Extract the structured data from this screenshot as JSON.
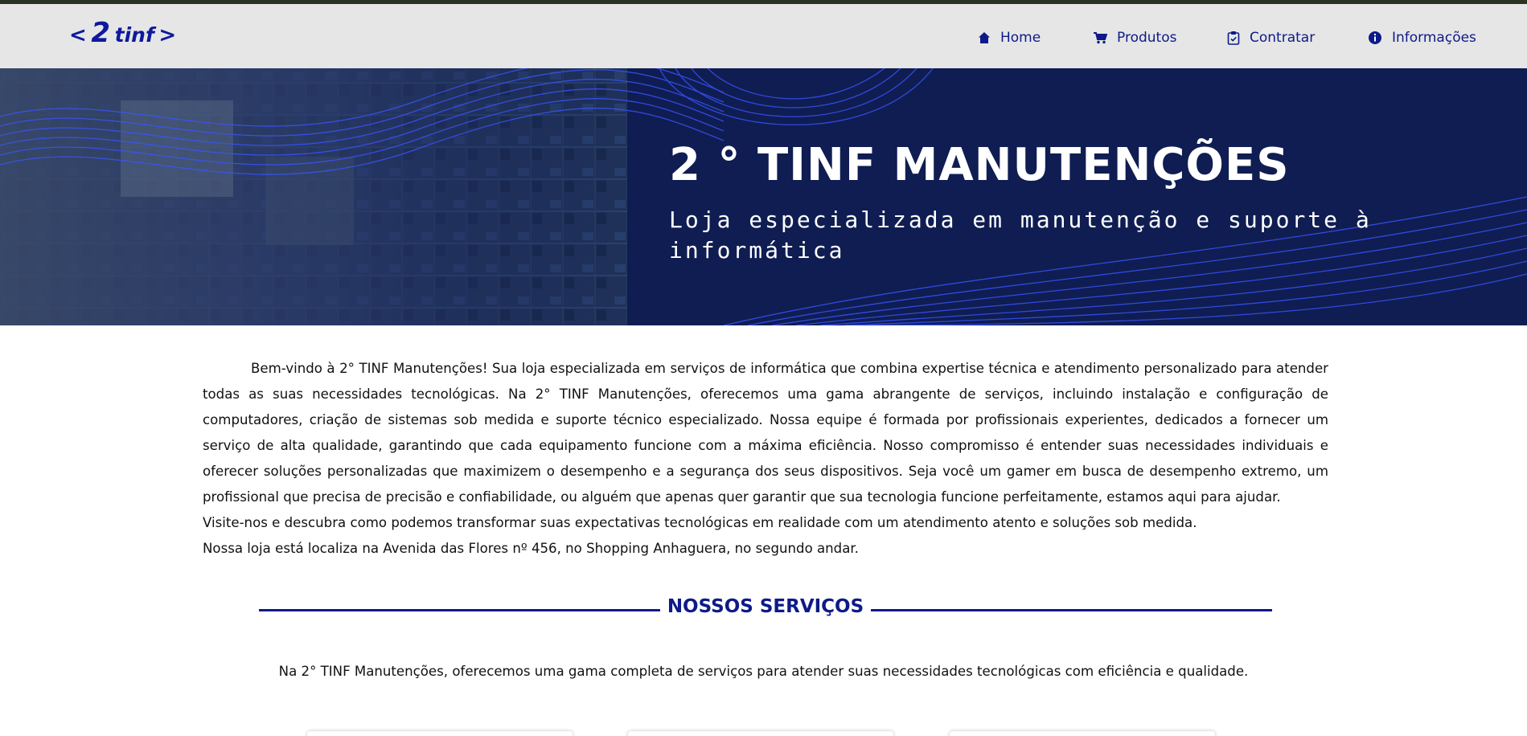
{
  "logo": {
    "open": "<",
    "digit": "2",
    "word": "tinf",
    "close": ">"
  },
  "nav": [
    {
      "label": "Home",
      "icon": "home-icon"
    },
    {
      "label": "Produtos",
      "icon": "cart-icon"
    },
    {
      "label": "Contratar",
      "icon": "clipboard-icon"
    },
    {
      "label": "Informações",
      "icon": "info-icon"
    }
  ],
  "hero": {
    "title": "2 ° TINF MANUTENÇÕES",
    "subtitle": "Loja especializada em manutenção e suporte à informática"
  },
  "intro": {
    "p1": "Bem-vindo à 2° TINF Manutenções! Sua loja especializada em serviços de informática que combina expertise técnica e atendimento personalizado para atender todas as suas necessidades tecnológicas. Na 2° TINF Manutenções, oferecemos uma gama abrangente de serviços, incluindo instalação e configuração de computadores, criação de sistemas sob medida e suporte técnico especializado. Nossa equipe é formada por profissionais experientes, dedicados a fornecer um serviço de alta qualidade, garantindo que cada equipamento funcione com a máxima eficiência. Nosso compromisso é entender suas necessidades individuais e oferecer soluções personalizadas que maximizem o desempenho e a segurança dos seus dispositivos. Seja você um gamer em busca de desempenho extremo, um profissional que precisa de precisão e confiabilidade, ou alguém que apenas quer garantir que sua tecnologia funcione perfeitamente, estamos aqui para ajudar.",
    "p2": "Visite-nos e descubra como podemos transformar suas expectativas tecnológicas em realidade com um atendimento atento e soluções sob medida.",
    "p3": "Nossa loja está localiza na Avenida das Flores nº 456, no Shopping Anhaguera, no segundo andar."
  },
  "services": {
    "title": "NOSSOS SERVIÇOS",
    "description": "Na 2° TINF Manutenções, oferecemos uma gama completa de serviços para atender suas necessidades tecnológicas com eficiência e qualidade."
  },
  "colors": {
    "accent": "#0d1a88",
    "header_bg": "#e6e6e6",
    "hero_bg": "#0f1d52",
    "hero_lines": "#3a55ff",
    "top_strip": "#2a3322"
  }
}
